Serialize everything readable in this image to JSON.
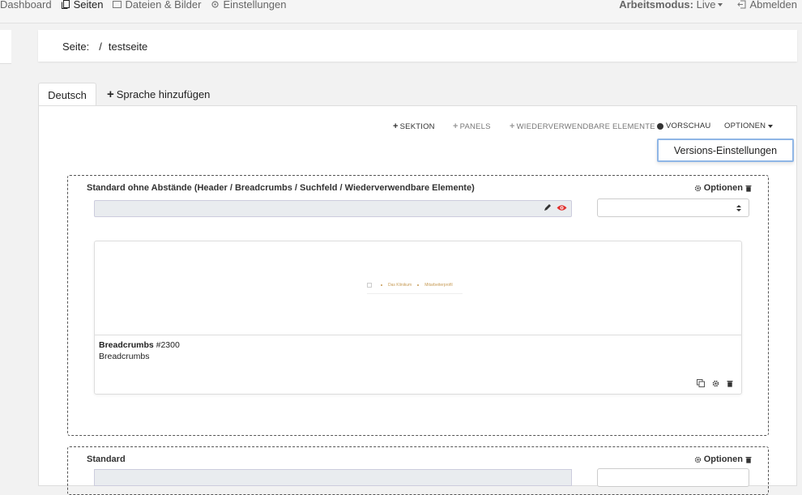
{
  "topbar": {
    "nav": [
      {
        "label": "Dashboard",
        "icon": "dashboard-icon"
      },
      {
        "label": "Seiten",
        "icon": "pages-icon"
      },
      {
        "label": "Dateien & Bilder",
        "icon": "files-icon"
      },
      {
        "label": "Einstellungen",
        "icon": "gear-icon"
      }
    ],
    "mode_label": "Arbeitsmodus:",
    "mode_value": "Live",
    "logout": "Abmelden"
  },
  "breadcrumb": {
    "label": "Seite:",
    "separator": "/",
    "page": "testseite"
  },
  "tabs": {
    "language": "Deutsch",
    "add_language": "Sprache hinzufügen"
  },
  "toolbar": {
    "section": "SEKTION",
    "panels": "PANELS",
    "reusable": "WIEDERVERWENDBARE ELEMENTE",
    "preview": "VORSCHAU",
    "options": "OPTIONEN"
  },
  "dropdown": {
    "item": "Versions-Einstellungen"
  },
  "sections": [
    {
      "title": "Standard ohne Abstände (Header / Breadcrumbs / Suchfeld / Wiederverwendbare Elemente)",
      "options_label": "Optionen",
      "element": {
        "name": "Breadcrumbs",
        "id": "#2300",
        "type": "Breadcrumbs",
        "preview_items": [
          "Das Klinikum",
          "Mitarbeiterprofil"
        ]
      }
    },
    {
      "title": "Standard",
      "options_label": "Optionen"
    }
  ],
  "colors": {
    "accent_focus": "#8fb6e6",
    "eye_red": "#e0302d",
    "preview_gold": "#c69a54"
  }
}
